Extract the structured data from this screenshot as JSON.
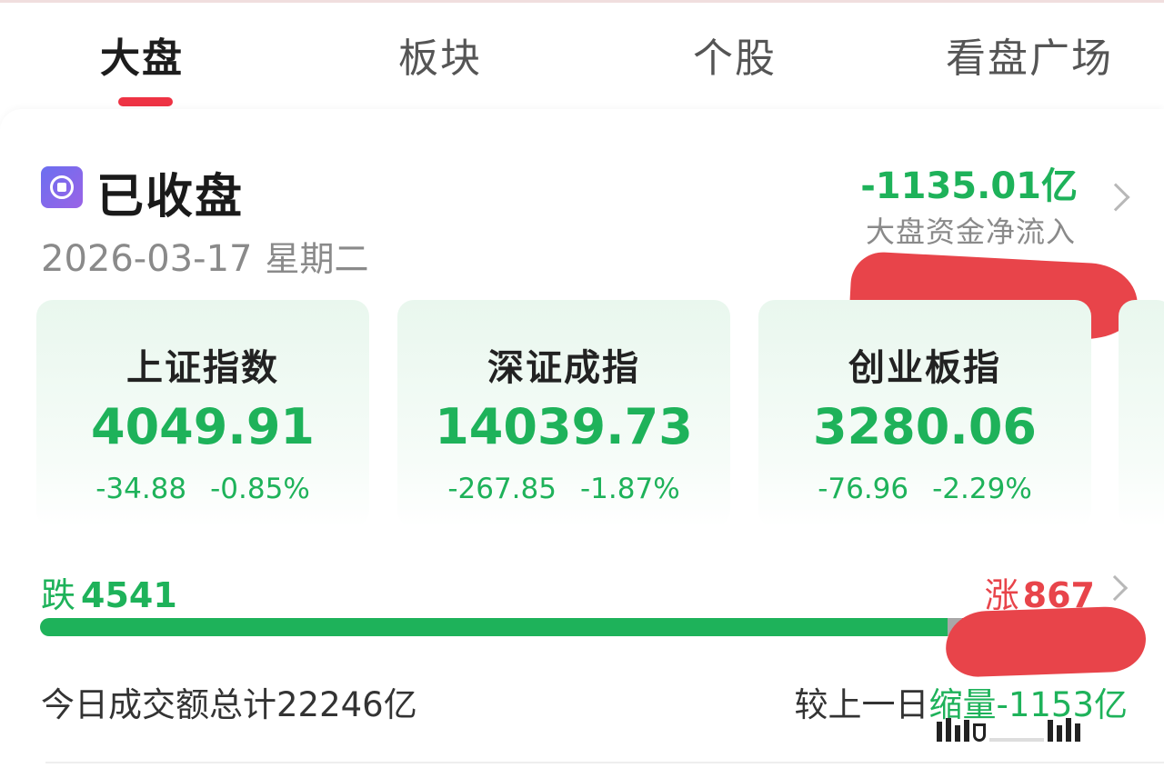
{
  "tabs": [
    {
      "label": "大盘",
      "active": true
    },
    {
      "label": "板块",
      "active": false
    },
    {
      "label": "个股",
      "active": false
    },
    {
      "label": "看盘广场",
      "active": false
    }
  ],
  "status": {
    "title": "已收盘",
    "date": "2026-03-17",
    "weekday": "星期二"
  },
  "capital_flow": {
    "value": "-1135.01亿",
    "label": "大盘资金净流入"
  },
  "indices": [
    {
      "name": "上证指数",
      "value": "4049.91",
      "change": "-34.88",
      "change_pct": "-0.85%"
    },
    {
      "name": "深证成指",
      "value": "14039.73",
      "change": "-267.85",
      "change_pct": "-1.87%"
    },
    {
      "name": "创业板指",
      "value": "3280.06",
      "change": "-76.96",
      "change_pct": "-2.29%"
    }
  ],
  "breadth": {
    "fall_label": "跌",
    "fall_count": "4541",
    "rise_label": "涨",
    "rise_count": "867",
    "fall_fraction": 0.825,
    "flat_fraction": 0.013
  },
  "turnover": {
    "text": "今日成交额总计22246亿",
    "compare_prefix": "较上一日",
    "compare_change": "缩量-1153亿"
  },
  "colors": {
    "down": "#1eb25a",
    "up": "#e8444a",
    "accent": "#ee3344"
  }
}
